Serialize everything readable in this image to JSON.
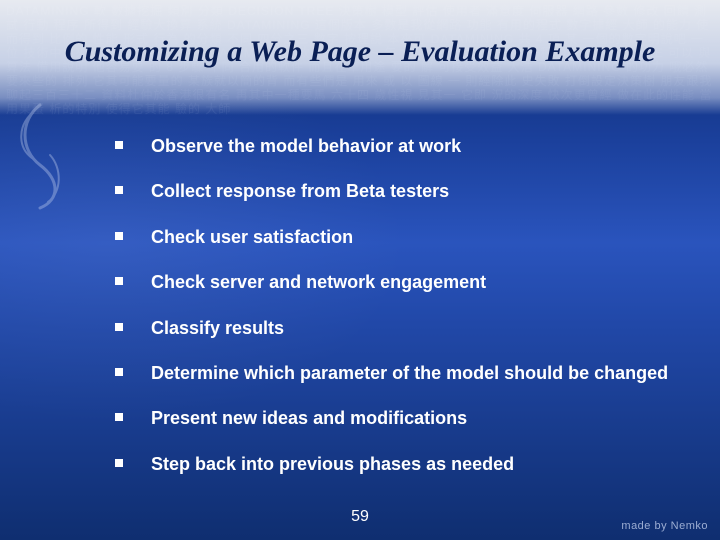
{
  "title": "Customizing a Web Page – Evaluation Example",
  "bullets": [
    "Observe the model behavior at work",
    "Collect response from Beta testers",
    "Check user satisfaction",
    "Check server and network engagement",
    "Classify results",
    "Determine which parameter of the model should be changed",
    "Present new ideas and modifications",
    "Step back into previous phases as needed"
  ],
  "page_number": "59",
  "footer": "made by Nemko"
}
